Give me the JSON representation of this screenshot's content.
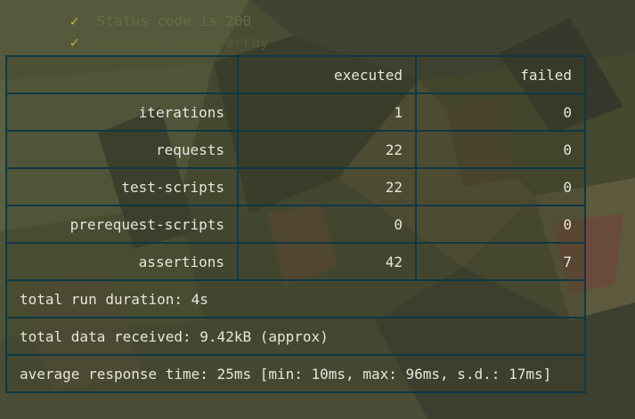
{
  "checks": [
    {
      "icon": "check-icon",
      "text": "Status code is 200"
    },
    {
      "icon": "check-icon",
      "text": "Response is an array"
    }
  ],
  "table": {
    "headers": {
      "label": "",
      "executed": "executed",
      "failed": "failed"
    },
    "rows": [
      {
        "label": "iterations",
        "executed": "1",
        "failed": "0",
        "status": "ok"
      },
      {
        "label": "requests",
        "executed": "22",
        "failed": "0",
        "status": "ok"
      },
      {
        "label": "test-scripts",
        "executed": "22",
        "failed": "0",
        "status": "ok"
      },
      {
        "label": "prerequest-scripts",
        "executed": "0",
        "failed": "0",
        "status": "ok"
      },
      {
        "label": "assertions",
        "executed": "42",
        "failed": "7",
        "status": "fail"
      }
    ],
    "summary": {
      "duration": "total run duration: 4s",
      "data_received": "total data received: 9.42kB (approx)",
      "response_time": "average response time: 25ms [min: 10ms, max: 96ms, s.d.: 17ms]"
    }
  },
  "colors": {
    "ok_label": "#9aa51e",
    "fail": "#e23a3a",
    "border": "#0f3845",
    "text": "#e6e6dc"
  }
}
